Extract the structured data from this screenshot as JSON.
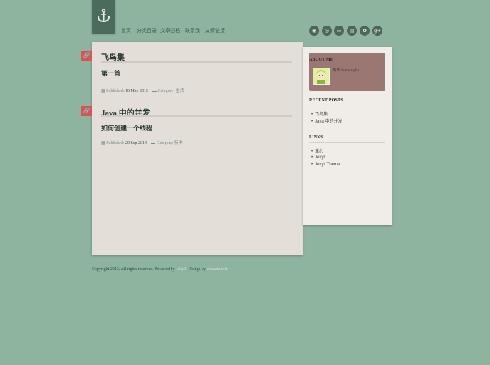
{
  "site": {
    "logo_icon": "anchor-icon"
  },
  "nav": {
    "items": [
      "首页",
      "分类目录",
      "文章归档",
      "联系我",
      "友情链接"
    ]
  },
  "social": {
    "icons": [
      "rss-icon",
      "weibo-icon",
      "douban-icon",
      "printer-icon",
      "twitter-icon",
      "google-plus-icon"
    ],
    "glyphs": [
      "◉",
      "◎",
      "▭",
      "▤",
      "✿",
      "g+"
    ]
  },
  "posts": [
    {
      "title": "飞鸟集",
      "subtitle": "第一首",
      "published_label": "Published:",
      "published_date": "10 May 2015",
      "category_label": "Category:",
      "category": "生活"
    },
    {
      "title": "Java 中的并发",
      "subtitle": "如何创建一个线程",
      "published_label": "Published:",
      "published_date": "20 Sep 2014",
      "category_label": "Category:",
      "category": "技术"
    }
  ],
  "sidebar": {
    "about_heading": "ABOUT ME",
    "about_text": "简单 zemasalpha",
    "recent_heading": "RECENT POSTS",
    "recent": [
      "飞鸟集",
      "Java 中的并发"
    ],
    "links_heading": "LINKS",
    "links": [
      "掌心",
      "Jekyll",
      "Jekyll Theme"
    ]
  },
  "footer": {
    "copyright": "Copyright 2013. All rights reserved. Powered by ",
    "powered_link": "Jekyll",
    "design_text": ", Design by ",
    "design_link": "zhanzm.info",
    "end": "."
  },
  "colors": {
    "background": "#8eb39f",
    "logo": "#4b6b5c",
    "post_marker": "#d9534f",
    "about_box": "#9a7772"
  }
}
